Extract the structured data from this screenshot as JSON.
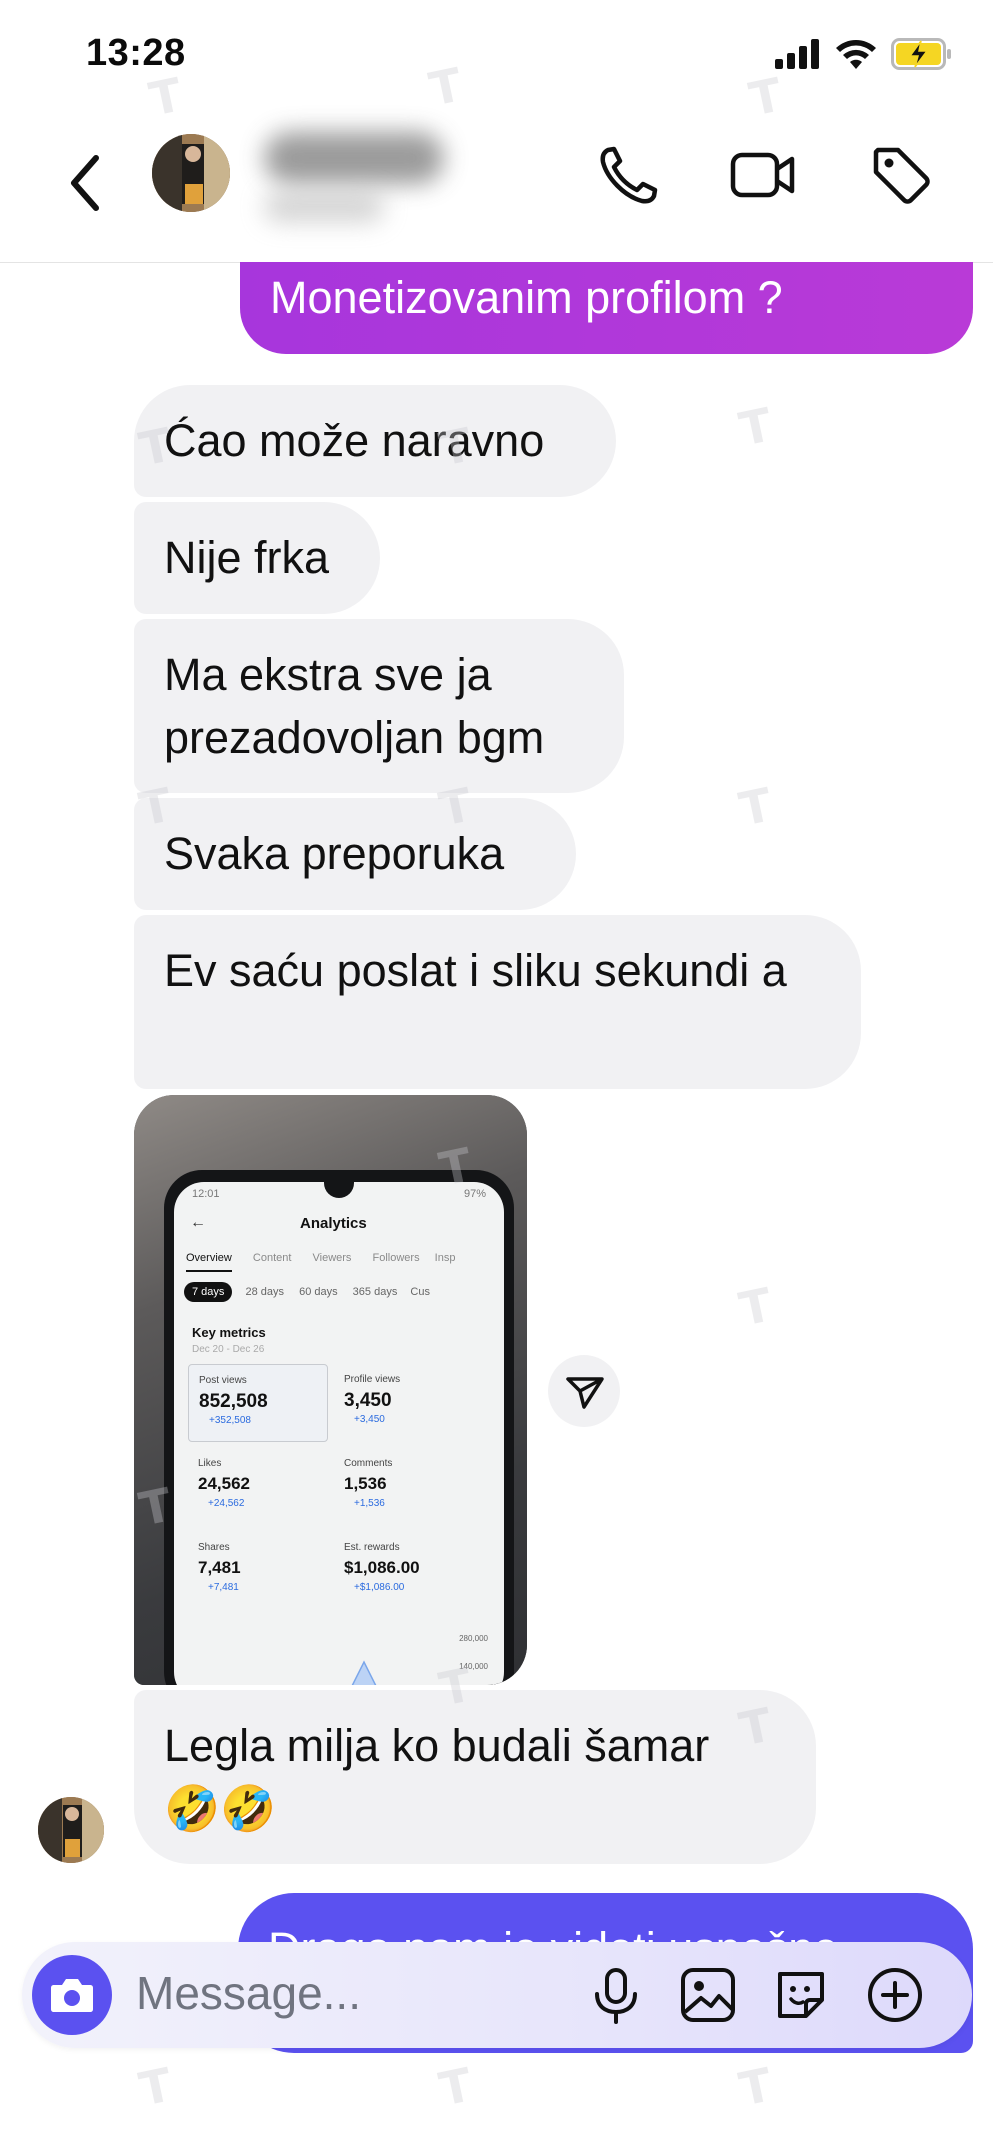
{
  "status_bar": {
    "time": "13:28"
  },
  "composer": {
    "placeholder": "Message..."
  },
  "messages": {
    "outgoing_top": "Monetizovanim profilom ?",
    "incoming": [
      "Ćao može naravno",
      "Nije frka",
      "Ma ekstra sve ja prezadovoljan bgm",
      "Svaka preporuka",
      "Ev saću poslat i sliku sekundi a"
    ],
    "incoming_last": "Legla milja ko budali šamar",
    "incoming_last_emoji": "🤣🤣",
    "outgoing_bottom": "Drago nam je videti uspešne"
  },
  "photo": {
    "status_time": "12:01",
    "status_right": "97%",
    "title": "Analytics",
    "tabs": [
      "Overview",
      "Content",
      "Viewers",
      "Followers",
      "Insp"
    ],
    "ranges": [
      "7 days",
      "28 days",
      "60 days",
      "365 days",
      "Cus"
    ],
    "key_metrics_title": "Key metrics",
    "date_range": "Dec 20 - Dec 26",
    "metrics": [
      {
        "label": "Post views",
        "value": "852,508",
        "delta": "+352,508"
      },
      {
        "label": "Profile views",
        "value": "3,450",
        "delta": "+3,450"
      },
      {
        "label": "Likes",
        "value": "24,562",
        "delta": "+24,562"
      },
      {
        "label": "Comments",
        "value": "1,536",
        "delta": "+1,536"
      },
      {
        "label": "Shares",
        "value": "7,481",
        "delta": "+7,481"
      },
      {
        "label": "Est. rewards",
        "value": "$1,086.00",
        "delta": "+$1,086.00"
      }
    ],
    "chart_ticks": [
      "280,000",
      "140,000"
    ]
  },
  "colors": {
    "outgoing_bubble": "#b037d9",
    "outgoing_bubble_2": "#5b51f0",
    "incoming_bubble": "#f1f1f3",
    "camera_button": "#5b51f0"
  }
}
